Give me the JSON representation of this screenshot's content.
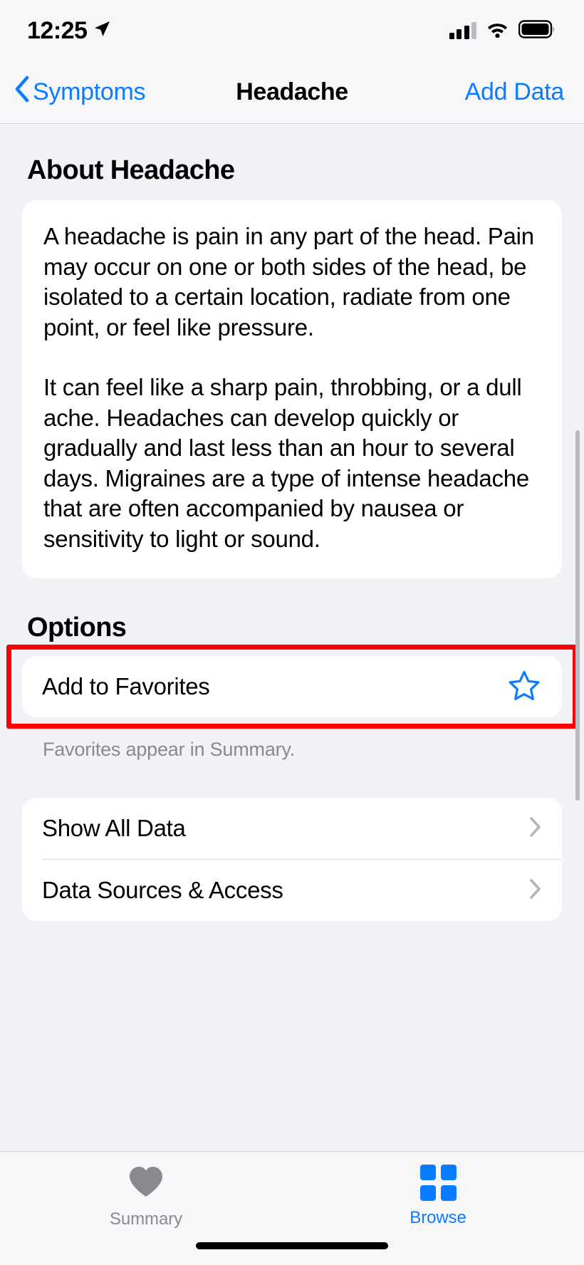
{
  "status_bar": {
    "time": "12:25",
    "location_icon": "location-arrow-icon",
    "cellular_icon": "cellular-bars-icon",
    "wifi_icon": "wifi-icon",
    "battery_icon": "battery-full-icon"
  },
  "nav": {
    "back_label": "Symptoms",
    "title": "Headache",
    "action_label": "Add Data"
  },
  "about": {
    "heading": "About Headache",
    "paragraph_1": "A headache is pain in any part of the head. Pain may occur on one or both sides of the head, be isolated to a certain location, radiate from one point, or feel like pressure.",
    "paragraph_2": "It can feel like a sharp pain, throbbing, or a dull ache. Headaches can develop quickly or gradually and last less than an hour to several days. Migraines are a type of intense headache that are often accompanied by nausea or sensitivity to light or sound."
  },
  "options": {
    "heading": "Options",
    "favorite_row": {
      "label": "Add to Favorites",
      "icon": "star-outline-icon"
    },
    "footnote": "Favorites appear in Summary.",
    "rows": [
      {
        "label": "Show All Data",
        "icon": "chevron-right-icon"
      },
      {
        "label": "Data Sources & Access",
        "icon": "chevron-right-icon"
      }
    ]
  },
  "tab_bar": {
    "tabs": [
      {
        "label": "Summary",
        "icon": "heart-icon",
        "active": false
      },
      {
        "label": "Browse",
        "icon": "grid-squares-icon",
        "active": true
      }
    ]
  },
  "colors": {
    "accent_blue": "#0a7cff",
    "highlight_red": "#ff0000",
    "page_background": "#f2f1f6",
    "card_background": "#ffffff",
    "muted_text": "#8a8a8e"
  }
}
